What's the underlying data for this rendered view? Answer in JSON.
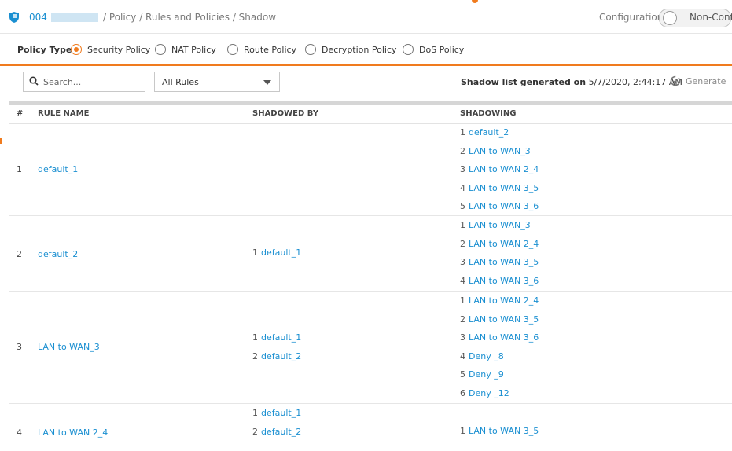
{
  "breadcrumb": {
    "device": "004",
    "path": "/ Policy / Rules and Policies / Shadow"
  },
  "mode": {
    "label": "Configuration",
    "toggle_label": "Non-Config"
  },
  "policy_type": {
    "label": "Policy Type",
    "options": [
      {
        "label": "Security Policy",
        "selected": true
      },
      {
        "label": "NAT Policy",
        "selected": false
      },
      {
        "label": "Route Policy",
        "selected": false
      },
      {
        "label": "Decryption Policy",
        "selected": false
      },
      {
        "label": "DoS Policy",
        "selected": false
      }
    ]
  },
  "toolbar": {
    "search_placeholder": "Search...",
    "filter_value": "All Rules",
    "shadow_prefix": "Shadow list generated on",
    "shadow_time": "5/7/2020, 2:44:17 AM",
    "generate_label": "Generate"
  },
  "table": {
    "headers": [
      "#",
      "RULE NAME",
      "SHADOWED BY",
      "SHADOWING"
    ],
    "rows": [
      {
        "num": "1",
        "name": "default_1",
        "shadowed_by": [],
        "shadowing": [
          {
            "n": "1",
            "name": "default_2"
          },
          {
            "n": "2",
            "name": "LAN to WAN_3"
          },
          {
            "n": "3",
            "name": "LAN to WAN 2_4"
          },
          {
            "n": "4",
            "name": "LAN to WAN 3_5"
          },
          {
            "n": "5",
            "name": "LAN to WAN 3_6"
          }
        ]
      },
      {
        "num": "2",
        "name": "default_2",
        "shadowed_by": [
          {
            "n": "1",
            "name": "default_1"
          }
        ],
        "shadowing": [
          {
            "n": "1",
            "name": "LAN to WAN_3"
          },
          {
            "n": "2",
            "name": "LAN to WAN 2_4"
          },
          {
            "n": "3",
            "name": "LAN to WAN 3_5"
          },
          {
            "n": "4",
            "name": "LAN to WAN 3_6"
          }
        ]
      },
      {
        "num": "3",
        "name": "LAN to WAN_3",
        "shadowed_by": [
          {
            "n": "1",
            "name": "default_1"
          },
          {
            "n": "2",
            "name": "default_2"
          }
        ],
        "shadowing": [
          {
            "n": "1",
            "name": "LAN to WAN 2_4"
          },
          {
            "n": "2",
            "name": "LAN to WAN 3_5"
          },
          {
            "n": "3",
            "name": "LAN to WAN 3_6"
          },
          {
            "n": "4",
            "name": "Deny _8"
          },
          {
            "n": "5",
            "name": "Deny _9"
          },
          {
            "n": "6",
            "name": "Deny _12"
          }
        ]
      },
      {
        "num": "4",
        "name": "LAN to WAN 2_4",
        "shadowed_by": [
          {
            "n": "1",
            "name": "default_1"
          },
          {
            "n": "2",
            "name": "default_2"
          }
        ],
        "shadowing": [
          {
            "n": "1",
            "name": "LAN to WAN 3_5"
          }
        ]
      }
    ]
  }
}
